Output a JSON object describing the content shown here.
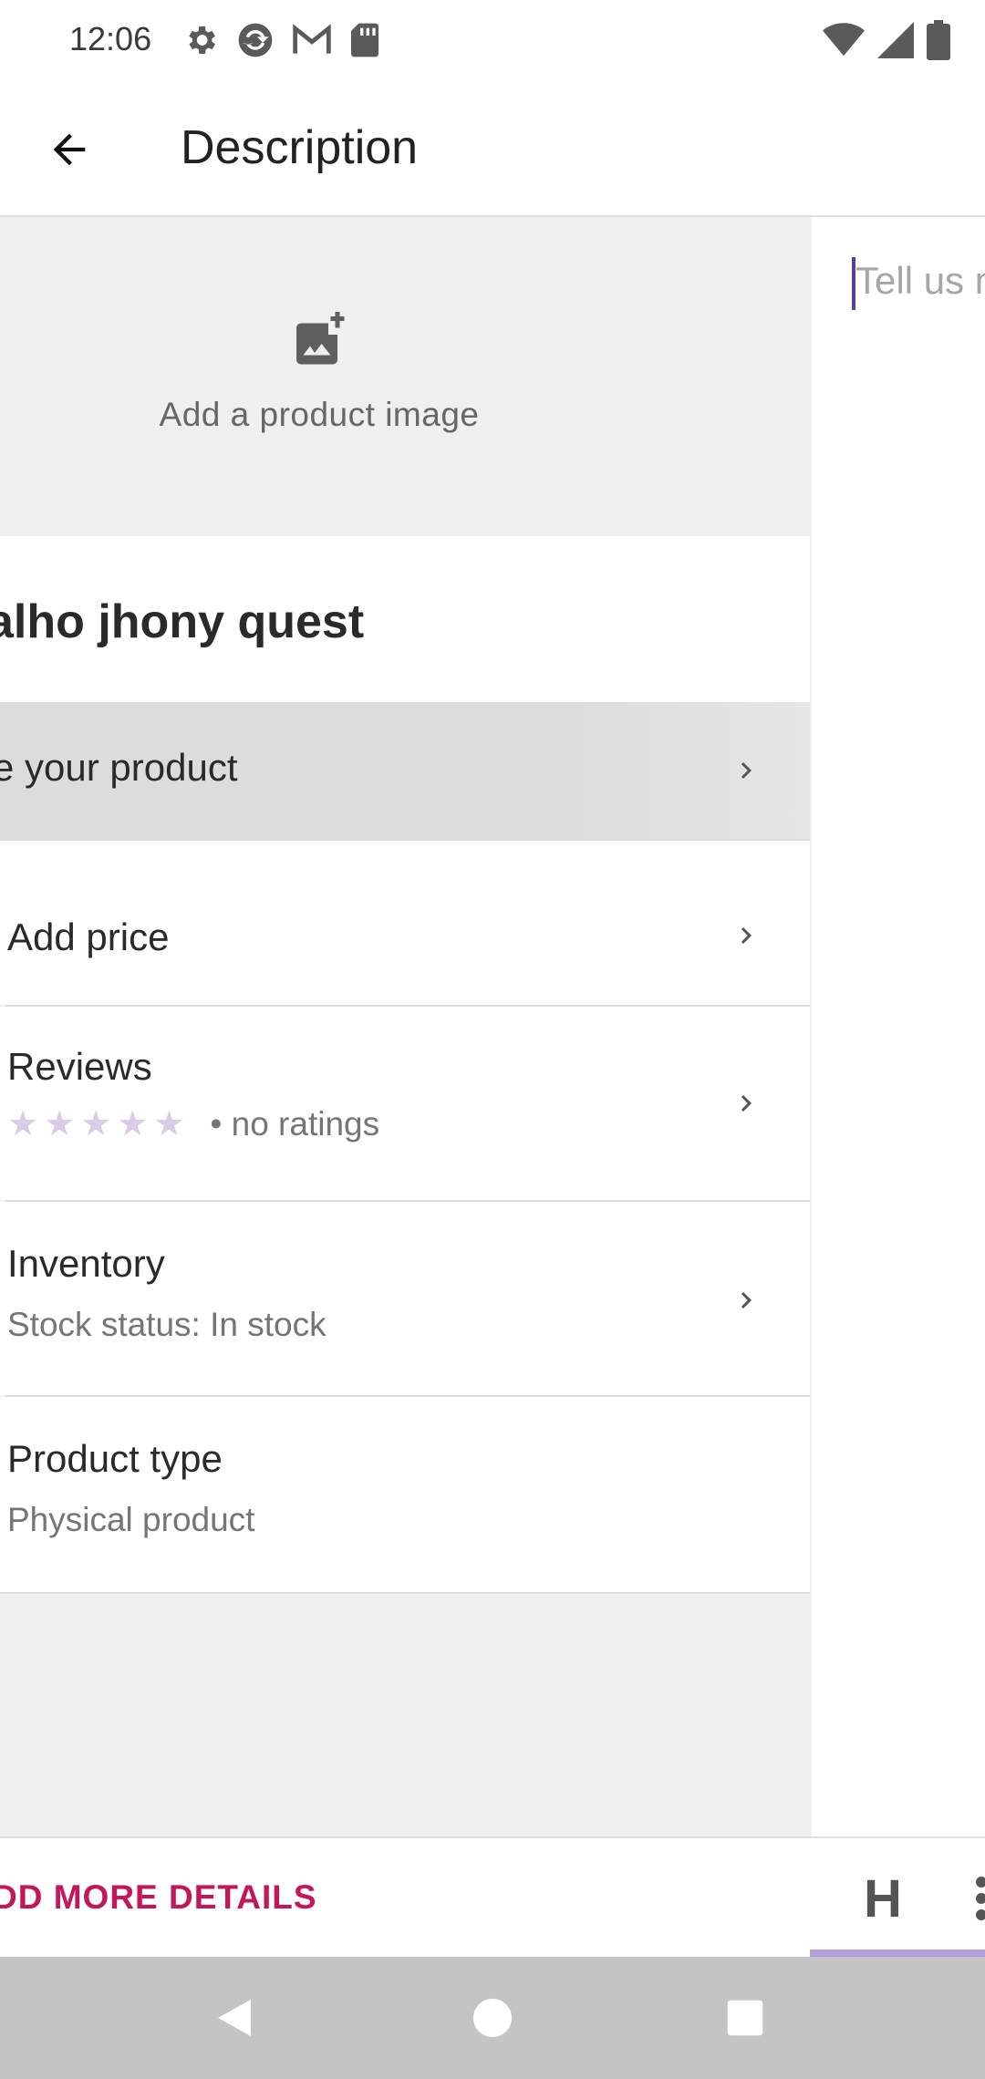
{
  "status_bar": {
    "time": "12:06",
    "left_icons": [
      "settings-icon",
      "sync-icon",
      "gmail-icon",
      "sd-card-icon"
    ],
    "right_icons": [
      "wifi-icon",
      "signal-icon",
      "battery-icon"
    ]
  },
  "app_bar": {
    "title": "Description",
    "back_icon": "arrow-back-icon"
  },
  "product": {
    "add_image_label": "Add a product image",
    "title": "alho jhony quest",
    "describe_label": "e your product"
  },
  "rows": {
    "price": {
      "label": "Add price"
    },
    "reviews": {
      "label": "Reviews",
      "rating": 0,
      "max_rating": 5,
      "rating_text": "• no ratings"
    },
    "inventory": {
      "label": "Inventory",
      "sub": "Stock status: In stock"
    },
    "product_type": {
      "label": "Product type",
      "sub": "Physical product"
    }
  },
  "footer": {
    "more_details": "DD MORE DETAILS",
    "heading_button": "H"
  },
  "editor": {
    "placeholder": "Tell us m"
  },
  "colors": {
    "accent_pink": "#c2185b",
    "accent_purple": "#5b3fa0",
    "star_inactive": "#d8cce6"
  }
}
